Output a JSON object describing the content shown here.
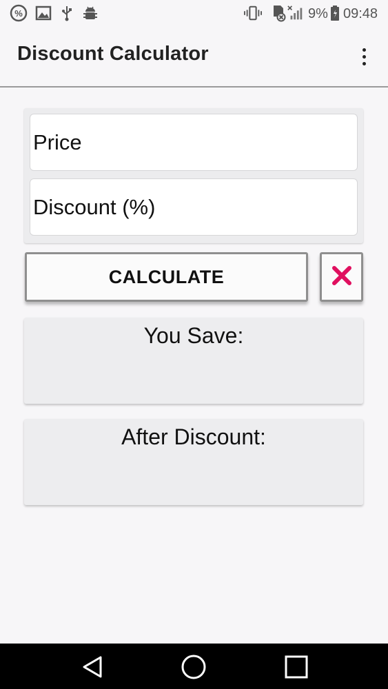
{
  "status_bar": {
    "battery_percent": "9%",
    "time": "09:48",
    "icons": [
      "discount-app-icon",
      "image-icon",
      "usb-icon",
      "android-debug-icon",
      "vibrate-icon",
      "sd-card-icon",
      "signal-icon",
      "battery-icon"
    ]
  },
  "app_bar": {
    "title": "Discount Calculator",
    "overflow_icon": "more-vert-icon"
  },
  "form": {
    "price_placeholder": "Price",
    "discount_placeholder": "Discount (%)"
  },
  "actions": {
    "calculate_label": "CALCULATE",
    "clear_icon": "close-icon",
    "clear_color": "#e0105f"
  },
  "results": {
    "save_label": "You Save:",
    "after_label": "After Discount:"
  },
  "nav_bar": {
    "icons": [
      "back-icon",
      "home-icon",
      "recents-icon"
    ]
  }
}
